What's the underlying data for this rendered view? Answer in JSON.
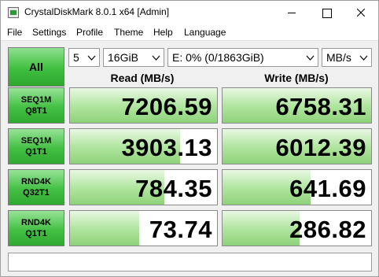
{
  "window": {
    "title": "CrystalDiskMark 8.0.1 x64 [Admin]"
  },
  "menu": [
    "File",
    "Settings",
    "Profile",
    "Theme",
    "Help",
    "Language"
  ],
  "controls": {
    "all_label": "All",
    "count": "5",
    "size": "16GiB",
    "drive": "E: 0% (0/1863GiB)",
    "unit": "MB/s"
  },
  "headers": {
    "read": "Read (MB/s)",
    "write": "Write (MB/s)"
  },
  "rows": [
    {
      "label1": "SEQ1M",
      "label2": "Q8T1",
      "read": "7206.59",
      "write": "6758.31",
      "read_fill": 1.0,
      "write_fill": 1.0
    },
    {
      "label1": "SEQ1M",
      "label2": "Q1T1",
      "read": "3903.13",
      "write": "6012.39",
      "read_fill": 0.75,
      "write_fill": 1.0
    },
    {
      "label1": "RND4K",
      "label2": "Q32T1",
      "read": "784.35",
      "write": "641.69",
      "read_fill": 0.64,
      "write_fill": 0.59
    },
    {
      "label1": "RND4K",
      "label2": "Q1T1",
      "read": "73.74",
      "write": "286.82",
      "read_fill": 0.47,
      "write_fill": 0.52
    }
  ],
  "status": {
    "text": ""
  },
  "colors": {
    "accent_green": "#3fbf3f",
    "bar_green": "#b2e6a1"
  }
}
